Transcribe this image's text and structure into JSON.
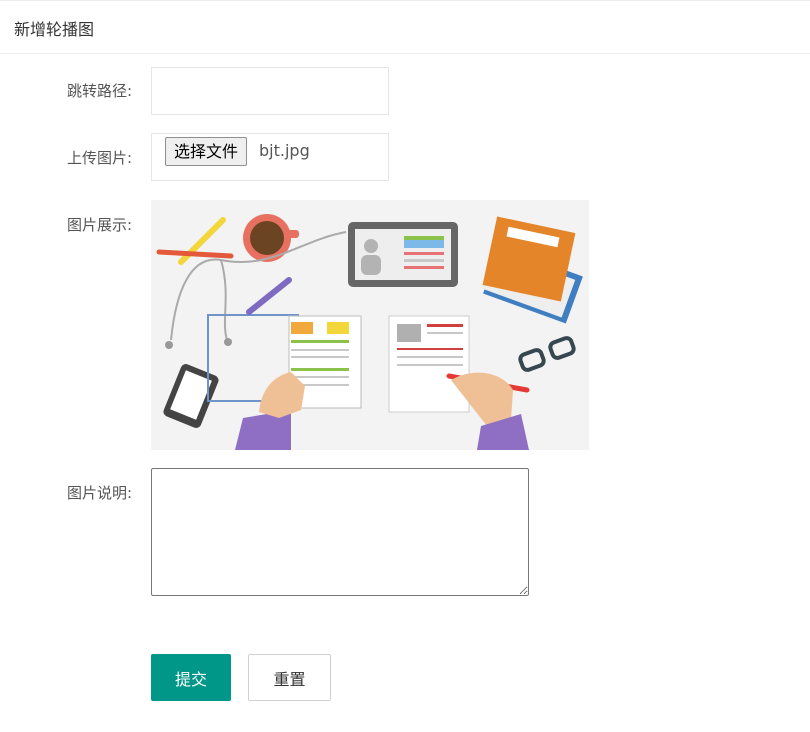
{
  "header": {
    "title": "新增轮播图"
  },
  "form": {
    "link": {
      "label": "跳转路径:",
      "value": "",
      "placeholder": ""
    },
    "upload": {
      "label": "上传图片:",
      "button_label": "选择文件",
      "file_name": "bjt.jpg"
    },
    "preview": {
      "label": "图片展示:"
    },
    "description": {
      "label": "图片说明:",
      "value": ""
    }
  },
  "actions": {
    "submit_label": "提交",
    "reset_label": "重置"
  },
  "colors": {
    "primary": "#009688",
    "border": "#e6e6e6"
  }
}
